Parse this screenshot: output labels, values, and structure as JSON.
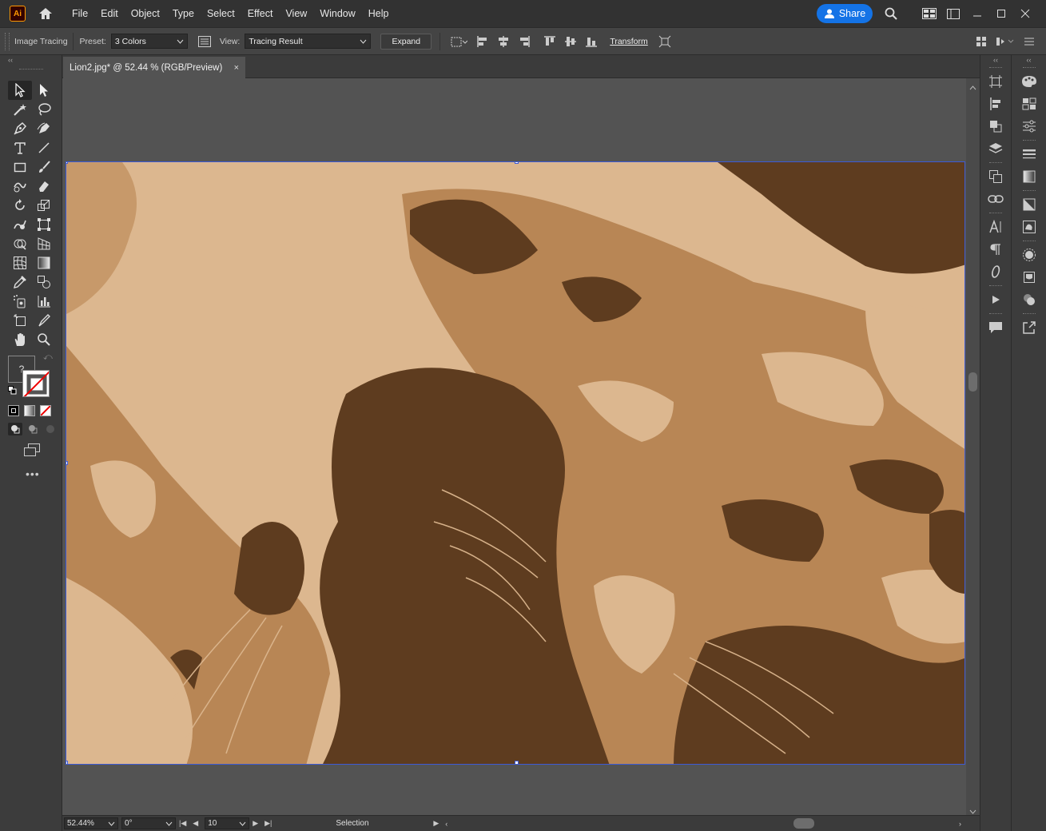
{
  "app": {
    "logo_text": "Ai",
    "menus": [
      "File",
      "Edit",
      "Object",
      "Type",
      "Select",
      "Effect",
      "View",
      "Window",
      "Help"
    ],
    "share_label": "Share"
  },
  "control_bar": {
    "panel_label": "Image Tracing",
    "preset_label": "Preset:",
    "preset_value": "3 Colors",
    "view_label": "View:",
    "view_value": "Tracing Result",
    "expand_label": "Expand",
    "transform_label": "Transform"
  },
  "document": {
    "tab_title": "Lion2.jpg* @ 52.44 % (RGB/Preview)",
    "close_glyph": "×"
  },
  "status_bar": {
    "zoom": "52.44%",
    "rotation": "0°",
    "artboard": "10",
    "tool": "Selection"
  },
  "colors": {
    "light": "#dcb78f",
    "mid": "#b88655",
    "dark": "#5e3c1f",
    "accent": "#1473e6",
    "selection": "#3d5bd6"
  },
  "tools": [
    "selection-tool",
    "direct-selection-tool",
    "magic-wand-tool",
    "lasso-tool",
    "pen-tool",
    "curvature-tool",
    "type-tool",
    "line-tool",
    "rectangle-tool",
    "paintbrush-tool",
    "shaper-tool",
    "eraser-tool",
    "rotate-tool",
    "scale-tool",
    "warp-tool",
    "free-transform-tool",
    "shape-builder-tool",
    "perspective-grid-tool",
    "mesh-tool",
    "gradient-tool",
    "eyedropper-tool",
    "blend-tool",
    "symbol-sprayer-tool",
    "column-graph-tool",
    "artboard-tool",
    "slice-tool",
    "hand-tool",
    "zoom-tool"
  ]
}
